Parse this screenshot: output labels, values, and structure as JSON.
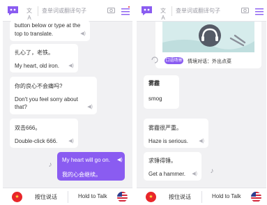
{
  "colors": {
    "accent": "#8a5cf1",
    "background": "#f1f1f3",
    "bubble": "#ffffff",
    "flag_cn": "#e8262a"
  },
  "left_screen": {
    "header": {
      "search_placeholder": "查单词或翻译句子",
      "icons": [
        "app-logo-icon",
        "translate-icon",
        "camera-icon",
        "menu-icon"
      ]
    },
    "messages": [
      {
        "lines": [
          "button below or type at the",
          "top to translate."
        ]
      },
      {
        "lines": [
          "扎心了，老铁。",
          "My heart, old iron."
        ]
      },
      {
        "lines": [
          "你的良心不会痛吗?",
          "Don't you feel sorry about",
          "that?"
        ]
      },
      {
        "lines": [
          "双击666。",
          "Double-click 666."
        ]
      }
    ],
    "user_message": {
      "lines": [
        "My heart will go on.",
        "我的心会继续。"
      ]
    },
    "bottom_bar": {
      "hold_cn": "按住说话",
      "hold_en": "Hold to Talk"
    }
  },
  "right_screen": {
    "header": {
      "search_placeholder": "查单词或翻译句子",
      "icons": [
        "app-logo-icon",
        "translate-icon",
        "camera-icon",
        "menu-icon"
      ]
    },
    "scene": {
      "badge": "口语场景",
      "label": "情境对话：外出点菜"
    },
    "messages": [
      {
        "lines": [
          "雾霾",
          "smog"
        ]
      },
      {
        "lines": [
          "雾霾很严重。",
          "Haze is serious."
        ]
      },
      {
        "lines": [
          "求锤得锤。",
          "Get a hammer."
        ]
      }
    ],
    "bottom_bar": {
      "hold_cn": "按住说话",
      "hold_en": "Hold to Talk"
    }
  }
}
